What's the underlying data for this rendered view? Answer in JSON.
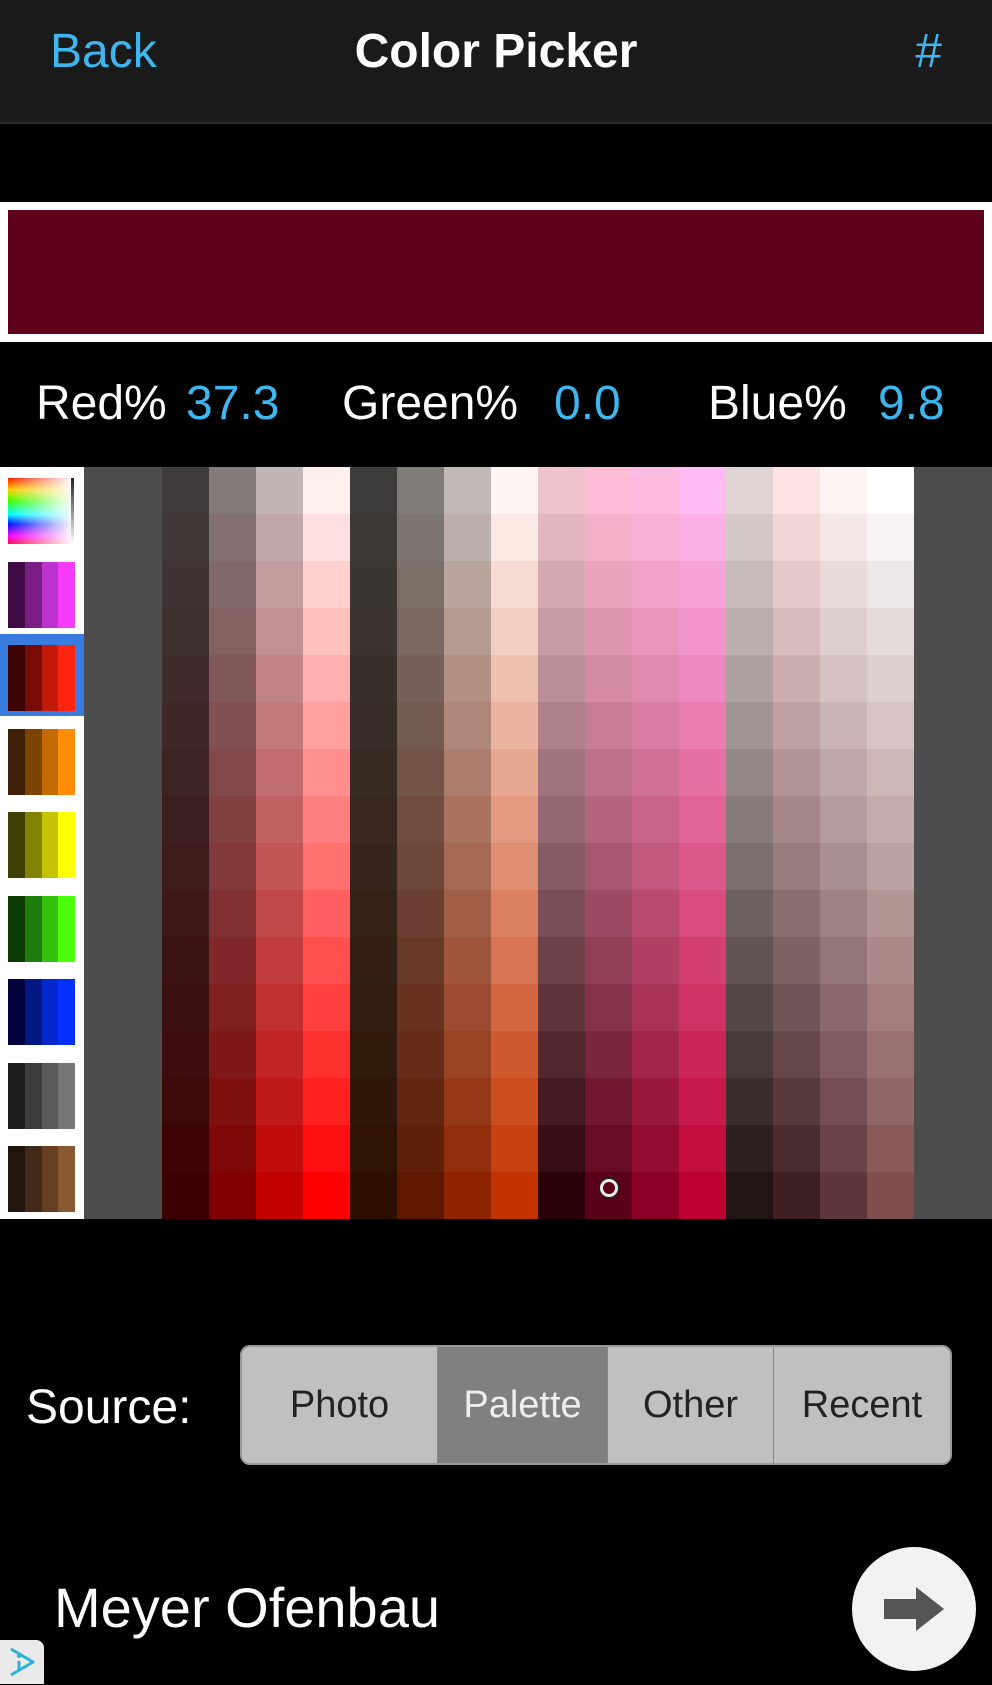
{
  "navbar": {
    "back_label": "Back",
    "title": "Color Picker",
    "hex_label": "#"
  },
  "current_color": {
    "hex": "#5f0019",
    "red_label": "Red%",
    "red_value": "37.3",
    "green_label": "Green%",
    "green_value": "0.0",
    "blue_label": "Blue%",
    "blue_value": "9.8"
  },
  "palettes": [
    {
      "name": "spectrum",
      "type": "spectrum",
      "selected": false
    },
    {
      "name": "purple",
      "colors": [
        "#3e0b44",
        "#7a1e86",
        "#bb33cc",
        "#f63cf8"
      ],
      "selected": false
    },
    {
      "name": "red",
      "colors": [
        "#3c0404",
        "#7a0c08",
        "#c01a0c",
        "#ff2410"
      ],
      "selected": true
    },
    {
      "name": "orange",
      "colors": [
        "#3e2008",
        "#7c4404",
        "#c46c04",
        "#ff8c04"
      ],
      "selected": false
    },
    {
      "name": "yellow",
      "colors": [
        "#404004",
        "#828204",
        "#c4c404",
        "#ffff04"
      ],
      "selected": false
    },
    {
      "name": "green",
      "colors": [
        "#0c3c04",
        "#1c7c0c",
        "#34c00c",
        "#4cff0c"
      ],
      "selected": false
    },
    {
      "name": "blue",
      "colors": [
        "#04043c",
        "#041884",
        "#0428cc",
        "#0430ff"
      ],
      "selected": false
    },
    {
      "name": "gray",
      "colors": [
        "#1e1e1e",
        "#3c3c3c",
        "#5a5a5a",
        "#767676"
      ],
      "selected": false
    },
    {
      "name": "brown",
      "colors": [
        "#22160c",
        "#442a18",
        "#663e22",
        "#88582e"
      ],
      "selected": false
    }
  ],
  "grid": {
    "rows": 16,
    "columns": [
      {
        "top": "#403b3b",
        "bottom": "#3c0000"
      },
      {
        "top": "#837979",
        "bottom": "#7e0000"
      },
      {
        "top": "#c1b5b5",
        "bottom": "#c10000"
      },
      {
        "top": "#fff0ee",
        "bottom": "#ff0000"
      },
      {
        "top": "#3e3c3a",
        "bottom": "#2e1000"
      },
      {
        "top": "#7f7c78",
        "bottom": "#5e1800"
      },
      {
        "top": "#bfb8b4",
        "bottom": "#8f2400"
      },
      {
        "top": "#fff5f2",
        "bottom": "#c33300"
      },
      {
        "top": "#f0c2cc",
        "bottom": "#2c0008"
      },
      {
        "top": "#ffbcd6",
        "bottom": "#5a0018"
      },
      {
        "top": "#ffbce2",
        "bottom": "#8a0024"
      },
      {
        "top": "#ffbcf2",
        "bottom": "#be0030"
      },
      {
        "top": "#e0d4d4",
        "bottom": "#201414"
      },
      {
        "top": "#ffe2e2",
        "bottom": "#3e2024"
      },
      {
        "top": "#fff4f4",
        "bottom": "#5e363a"
      },
      {
        "top": "#ffffff",
        "bottom": "#804e4c"
      }
    ],
    "selected_column": 9,
    "selected_row": 15
  },
  "source": {
    "label": "Source:",
    "options": [
      "Photo",
      "Palette",
      "Other",
      "Recent"
    ],
    "selected": "Palette"
  },
  "ad": {
    "text": "Meyer Ofenbau"
  }
}
